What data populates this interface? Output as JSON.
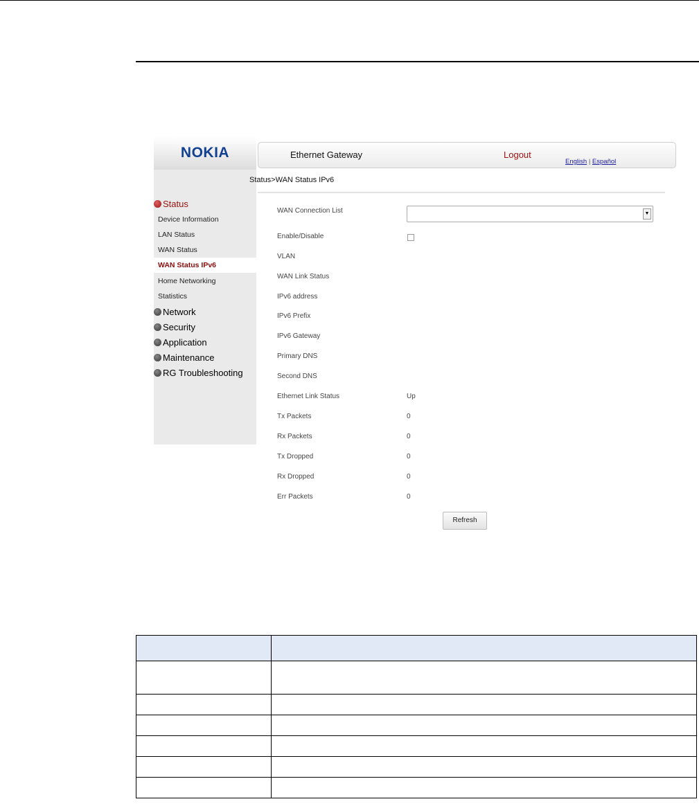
{
  "screenshot": {
    "brand": "NOKIA",
    "header": {
      "title": "Ethernet Gateway",
      "logout": "Logout",
      "lang_en": "English",
      "lang_sep": "|",
      "lang_es": "Español"
    },
    "breadcrumb": "Status>WAN Status IPv6",
    "sidebar": {
      "status_label": "Status",
      "status_items": [
        "Device Information",
        "LAN Status",
        "WAN Status",
        "WAN Status IPv6",
        "Home Networking",
        "Statistics"
      ],
      "sections": [
        "Network",
        "Security",
        "Application",
        "Maintenance",
        "RG Troubleshooting"
      ]
    },
    "fields": [
      {
        "label": "WAN Connection List",
        "value": ""
      },
      {
        "label": "Enable/Disable",
        "value": ""
      },
      {
        "label": "VLAN",
        "value": ""
      },
      {
        "label": "WAN Link Status",
        "value": ""
      },
      {
        "label": "IPv6 address",
        "value": ""
      },
      {
        "label": "IPv6 Prefix",
        "value": ""
      },
      {
        "label": "IPv6 Gateway",
        "value": ""
      },
      {
        "label": "Primary DNS",
        "value": ""
      },
      {
        "label": "Second DNS",
        "value": ""
      },
      {
        "label": "Ethernet Link Status",
        "value": "Up"
      },
      {
        "label": "Tx Packets",
        "value": "0"
      },
      {
        "label": "Rx Packets",
        "value": "0"
      },
      {
        "label": "Tx Dropped",
        "value": "0"
      },
      {
        "label": "Rx Dropped",
        "value": "0"
      },
      {
        "label": "Err Packets",
        "value": "0"
      }
    ],
    "enable_checked": false,
    "refresh_label": "Refresh"
  },
  "doc_table": {
    "header": [
      "",
      ""
    ],
    "rows": [
      [
        "",
        ""
      ],
      [
        "",
        ""
      ],
      [
        "",
        ""
      ],
      [
        "",
        ""
      ],
      [
        "",
        ""
      ],
      [
        "",
        ""
      ]
    ]
  }
}
